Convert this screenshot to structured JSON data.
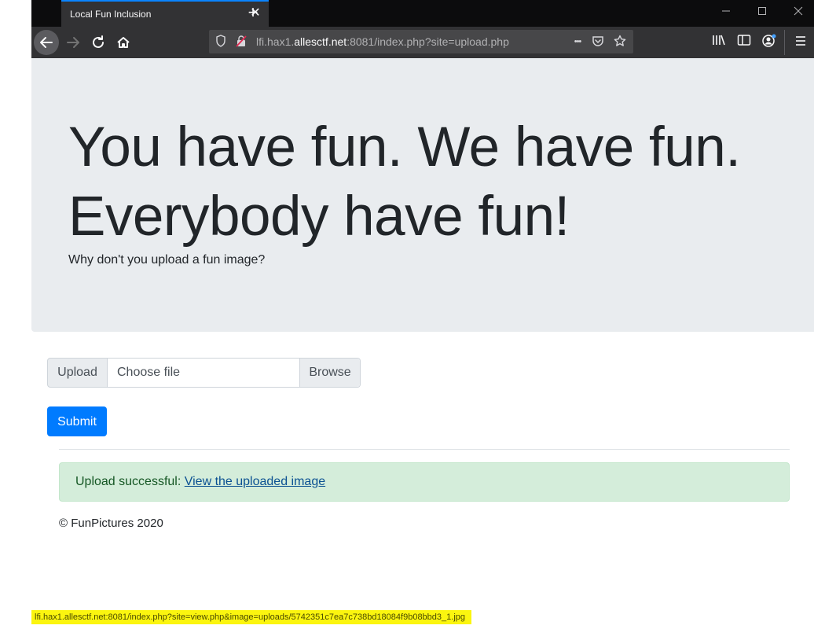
{
  "browser": {
    "tab_title": "Local Fun Inclusion",
    "tab_close_glyph": "✕",
    "new_tab_glyph": "+",
    "url_prefix": "lfi.hax1.",
    "url_domain": "allesctf.net",
    "url_suffix": ":8081/index.php?site=upload.php",
    "page_actions_glyph": "•••",
    "status_url": "lfi.hax1.allesctf.net:8081/index.php?site=view.php&image=uploads/5742351c7ea7c738bd18084f9b08bbd3_1.jpg"
  },
  "jumbotron": {
    "heading": "You have fun. We have fun. Everybody have fun!",
    "lead": "Why don't you upload a fun image?"
  },
  "form": {
    "prepend_label": "Upload",
    "file_placeholder": "Choose file",
    "browse_label": "Browse",
    "submit_label": "Submit"
  },
  "alert": {
    "message": "Upload successful: ",
    "link_text": "View the uploaded image"
  },
  "footer": {
    "copyright": "© FunPictures 2020"
  },
  "colors": {
    "primary": "#007bff",
    "success_bg": "#d4edda",
    "success_text": "#155724",
    "jumbotron_bg": "#e9ecef",
    "status_highlight": "#fbf50f"
  }
}
